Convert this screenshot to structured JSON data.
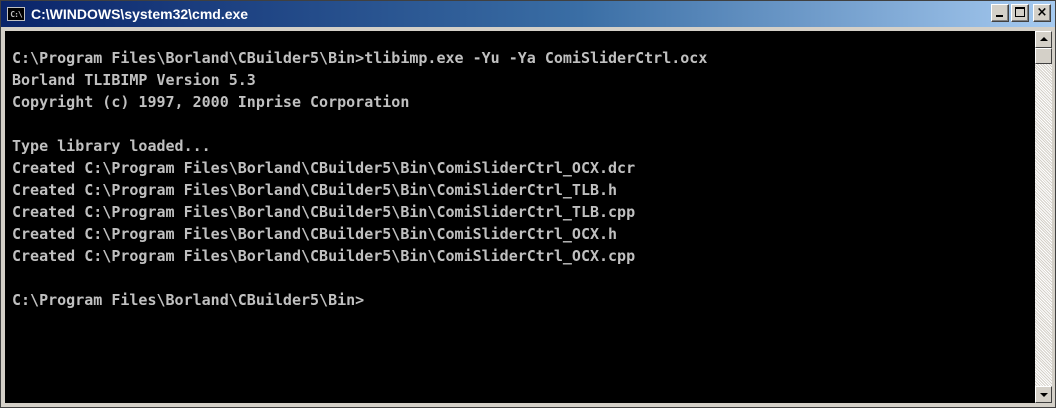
{
  "window": {
    "title": "C:\\WINDOWS\\system32\\cmd.exe",
    "icon_label": "C:\\",
    "buttons": {
      "minimize_icon": "minimize-icon",
      "maximize_icon": "maximize-icon",
      "close_icon": "close-icon",
      "close_glyph": "×"
    }
  },
  "console": {
    "lines": [
      "C:\\Program Files\\Borland\\CBuilder5\\Bin>tlibimp.exe -Yu -Ya ComiSliderCtrl.ocx",
      "Borland TLIBIMP Version 5.3",
      "Copyright (c) 1997, 2000 Inprise Corporation",
      "",
      "Type library loaded...",
      "Created C:\\Program Files\\Borland\\CBuilder5\\Bin\\ComiSliderCtrl_OCX.dcr",
      "Created C:\\Program Files\\Borland\\CBuilder5\\Bin\\ComiSliderCtrl_TLB.h",
      "Created C:\\Program Files\\Borland\\CBuilder5\\Bin\\ComiSliderCtrl_TLB.cpp",
      "Created C:\\Program Files\\Borland\\CBuilder5\\Bin\\ComiSliderCtrl_OCX.h",
      "Created C:\\Program Files\\Borland\\CBuilder5\\Bin\\ComiSliderCtrl_OCX.cpp",
      "",
      "C:\\Program Files\\Borland\\CBuilder5\\Bin>"
    ]
  },
  "colors": {
    "console_bg": "#000000",
    "console_fg": "#c0c0c0",
    "title_start": "#0a246a",
    "title_end": "#a6caf0"
  }
}
